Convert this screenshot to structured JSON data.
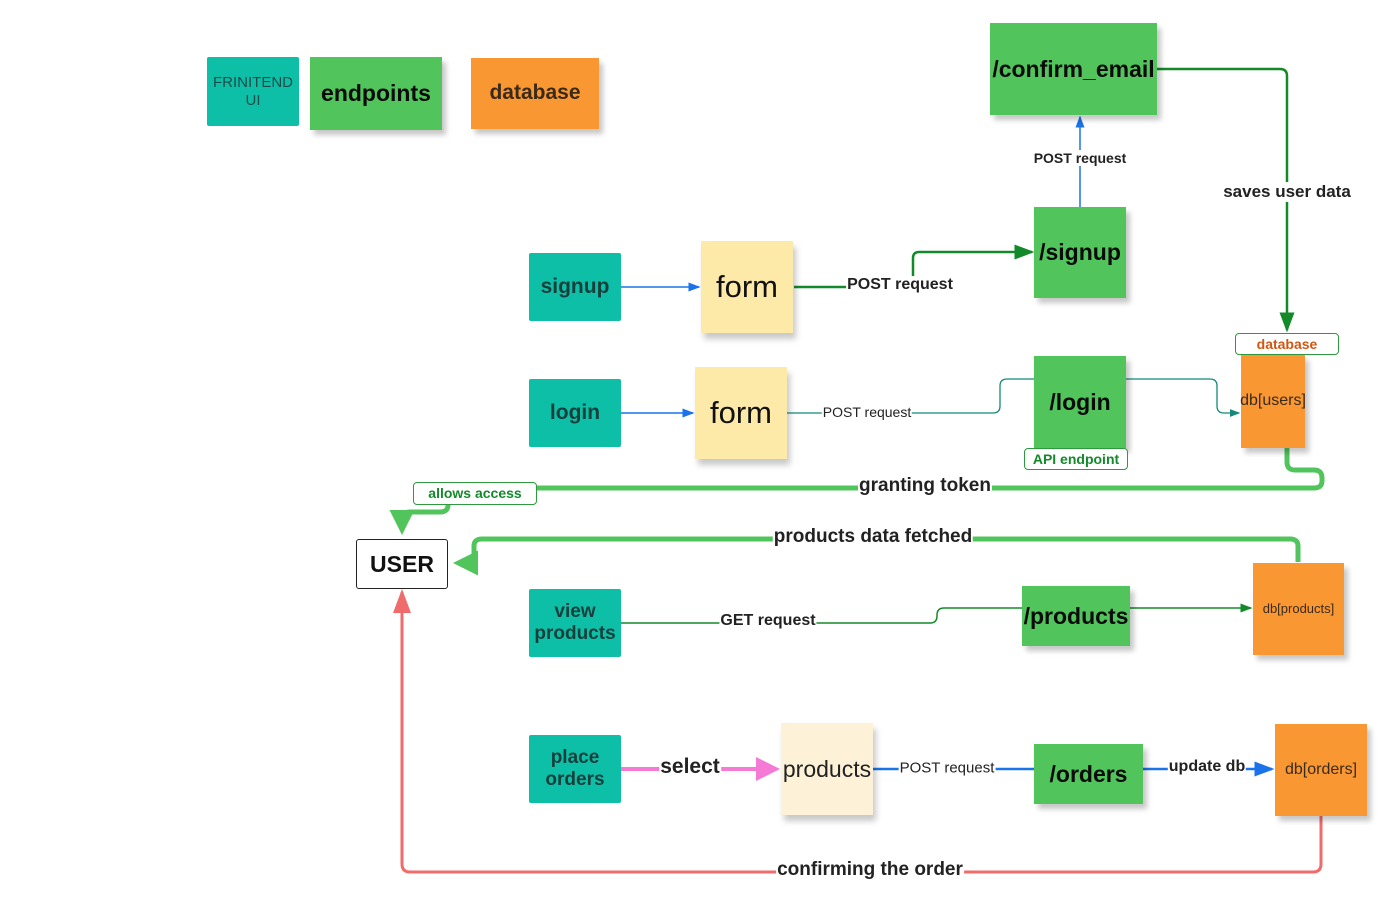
{
  "legend": {
    "frontend": "FRINITEND UI",
    "endpoints": "endpoints",
    "database": "database"
  },
  "nodes": {
    "confirm_email": "/confirm_email",
    "signup_endpoint": "/signup",
    "signup_ui": "signup",
    "signup_form": "form",
    "login_ui": "login",
    "login_form": "form",
    "login_endpoint": "/login",
    "api_endpoint_tag": "API endpoint",
    "database_tag": "database",
    "db_users": "db[users]",
    "user": "USER",
    "allows_access_tag": "allows access",
    "view_products_ui": "view products",
    "products_endpoint": "/products",
    "db_products": "db[products]",
    "place_orders_ui": "place orders",
    "products_note": "products",
    "orders_endpoint": "/orders",
    "db_orders": "db[orders]"
  },
  "edges": {
    "signup_post": "POST request",
    "confirm_post": "POST request",
    "saves_user_data": "saves user data",
    "login_post": "POST request",
    "granting_token": "granting token",
    "products_fetched": "products data fetched",
    "get_request": "GET request",
    "select": "select",
    "orders_post": "POST request",
    "update_db": "update db",
    "confirming_order": "confirming the order"
  },
  "colors": {
    "frontend": "#0ebfa7",
    "endpoint": "#52c45c",
    "database": "#f99733",
    "form": "#fde9a8",
    "blue": "#1a73e8",
    "green": "#2e9a3e",
    "pink": "#f47ad6",
    "red": "#f06b6b"
  }
}
